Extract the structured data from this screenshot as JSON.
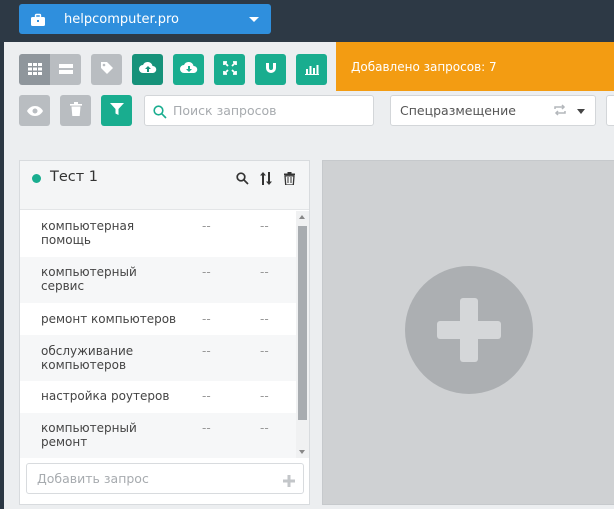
{
  "project": {
    "name": "helpcomputer.pro",
    "icon": "briefcase-icon"
  },
  "toolbar": {
    "buttons": [
      {
        "icon": "grid-view-icon"
      },
      {
        "icon": "list-view-icon"
      },
      {
        "icon": "tag-icon"
      },
      {
        "icon": "cloud-upload-icon"
      },
      {
        "icon": "cloud-download-icon"
      },
      {
        "icon": "expand-icon"
      },
      {
        "icon": "magnet-icon"
      },
      {
        "icon": "bar-chart-icon"
      },
      {
        "icon": "eye-icon"
      },
      {
        "icon": "trash-icon"
      },
      {
        "icon": "filter-icon"
      }
    ]
  },
  "notification": {
    "text": "Добавлено запросов: 7"
  },
  "search": {
    "placeholder": "Поиск запросов",
    "value": ""
  },
  "placement_select": {
    "selected": "Спецразмещение"
  },
  "group": {
    "title": "Тест 1",
    "status_color": "#19ad8f",
    "rows": [
      {
        "keyword_line1": "компьютерная",
        "keyword_line2": "помощь",
        "col1": "--",
        "col2": "--"
      },
      {
        "keyword_line1": "компьютерный",
        "keyword_line2": "сервис",
        "col1": "--",
        "col2": "--"
      },
      {
        "keyword_line1": "ремонт компьютеров",
        "keyword_line2": "",
        "col1": "--",
        "col2": "--"
      },
      {
        "keyword_line1": "обслуживание",
        "keyword_line2": "компьютеров",
        "col1": "--",
        "col2": "--"
      },
      {
        "keyword_line1": "настройка роутеров",
        "keyword_line2": "",
        "col1": "--",
        "col2": "--"
      },
      {
        "keyword_line1": "компьютерный",
        "keyword_line2": "ремонт",
        "col1": "--",
        "col2": "--"
      }
    ],
    "add_placeholder": "Добавить запрос"
  },
  "colors": {
    "accent_teal": "#19ad8f",
    "accent_blue": "#2f8fdd",
    "notify_orange": "#f39c12"
  }
}
